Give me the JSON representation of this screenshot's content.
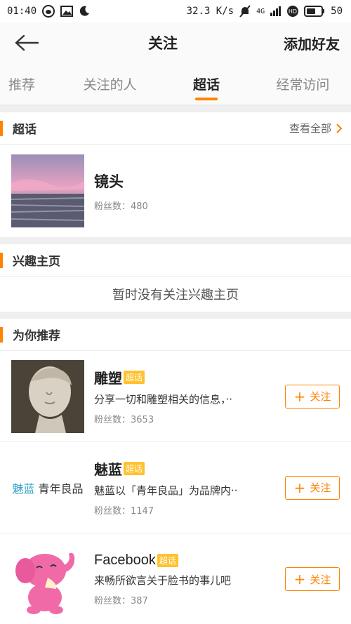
{
  "status_bar": {
    "time": "01:40",
    "network_speed": "32.3 K/s",
    "network_type": "4G",
    "battery": "50",
    "icons": [
      "weibo-icon",
      "image-icon",
      "moon-icon",
      "mute-icon",
      "signal-icon",
      "hd-icon",
      "battery-icon"
    ]
  },
  "nav": {
    "title": "关注",
    "action": "添加好友"
  },
  "tabs": [
    {
      "label": "推荐",
      "active": false
    },
    {
      "label": "关注的人",
      "active": false
    },
    {
      "label": "超话",
      "active": true
    },
    {
      "label": "经常访问",
      "active": false
    }
  ],
  "supertopic_section": {
    "title": "超话",
    "see_all": "查看全部",
    "items": [
      {
        "name": "镜头",
        "fans_label": "粉丝数：",
        "fans": "480"
      }
    ]
  },
  "interest_section": {
    "title": "兴趣主页",
    "empty_text": "暂时没有关注兴趣主页"
  },
  "recommend_section": {
    "title": "为你推荐",
    "items": [
      {
        "name": "雕塑",
        "badge": "超话",
        "desc": "分享一切和雕塑相关的信息，··",
        "fans_label": "粉丝数：",
        "fans": "3653",
        "follow_label": "关注"
      },
      {
        "name": "魅蓝",
        "badge": "超话",
        "desc": "魅蓝以「青年良品」为品牌内··",
        "fans_label": "粉丝数：",
        "fans": "1147",
        "follow_label": "关注",
        "logo_text_blue": "魅蓝",
        "logo_text": "青年良品"
      },
      {
        "name": "Facebook",
        "badge": "超话",
        "desc": "来畅所欲言关于脸书的事儿吧",
        "fans_label": "粉丝数：",
        "fans": "387",
        "follow_label": "关注"
      }
    ]
  },
  "colors": {
    "accent": "#ff8200",
    "badge": "#ffc12e",
    "divider": "#efefef"
  }
}
